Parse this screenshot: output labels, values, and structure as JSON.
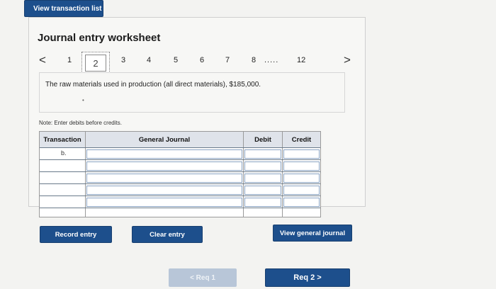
{
  "top_button": "View transaction list",
  "worksheet": {
    "title": "Journal entry worksheet",
    "pager": {
      "prev": "<",
      "next": ">",
      "pages": [
        "1",
        "2",
        "3",
        "4",
        "5",
        "6",
        "7",
        "8",
        ".....",
        "12"
      ],
      "current": "2"
    },
    "instruction": "The raw materials used in production (all direct materials), $185,000.",
    "instruction_marker": "•",
    "note": "Note: Enter debits before credits.",
    "table": {
      "headers": {
        "transaction": "Transaction",
        "journal": "General Journal",
        "debit": "Debit",
        "credit": "Credit"
      },
      "rows": [
        {
          "transaction": "b."
        },
        {
          "transaction": ""
        },
        {
          "transaction": ""
        },
        {
          "transaction": ""
        },
        {
          "transaction": ""
        },
        {
          "transaction": ""
        }
      ]
    },
    "buttons": {
      "record": "Record entry",
      "clear": "Clear entry",
      "view_journal": "View general journal"
    }
  },
  "nav": {
    "prev_label": "< Req 1",
    "next_label": "Req 2 >"
  },
  "colors": {
    "brand_blue": "#1d4f8c",
    "disabled_blue": "#b8c6d8",
    "header_gray": "#dfe3ea"
  }
}
